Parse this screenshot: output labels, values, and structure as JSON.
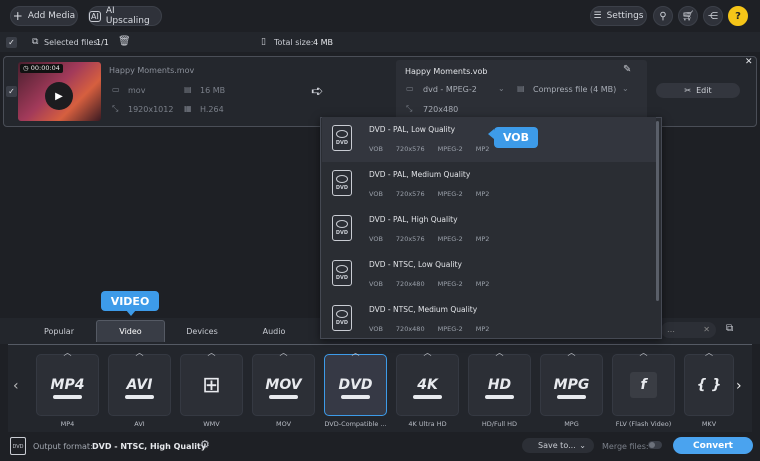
{
  "toolbar": {
    "add_media": "Add Media",
    "ai_upscaling": "AI Upscaling",
    "settings": "Settings"
  },
  "status": {
    "selected_label": "Selected files:",
    "selected_value": "1/1",
    "total_label": "Total size:",
    "total_value": "4 MB"
  },
  "file": {
    "duration": "00:00:04",
    "name": "Happy Moments.mov",
    "container": "mov",
    "size": "16 MB",
    "resolution": "1920x1012",
    "codec": "H.264"
  },
  "output": {
    "name": "Happy Moments.vob",
    "format": "dvd - MPEG-2",
    "compress": "Compress file (4 MB)",
    "resolution": "720x480",
    "edit": "Edit"
  },
  "dropdown": [
    {
      "name": "DVD - PAL, Low Quality",
      "specs": [
        "VOB",
        "720x576",
        "MPEG-2",
        "MP2"
      ]
    },
    {
      "name": "DVD - PAL, Medium Quality",
      "specs": [
        "VOB",
        "720x576",
        "MPEG-2",
        "MP2"
      ]
    },
    {
      "name": "DVD - PAL, High Quality",
      "specs": [
        "VOB",
        "720x576",
        "MPEG-2",
        "MP2"
      ]
    },
    {
      "name": "DVD - NTSC, Low Quality",
      "specs": [
        "VOB",
        "720x480",
        "MPEG-2",
        "MP2"
      ]
    },
    {
      "name": "DVD - NTSC, Medium Quality",
      "specs": [
        "VOB",
        "720x480",
        "MPEG-2",
        "MP2"
      ]
    }
  ],
  "callouts": {
    "vob": "VOB",
    "video": "VIDEO"
  },
  "tabs": [
    "Popular",
    "Video",
    "Devices",
    "Audio"
  ],
  "formats": [
    {
      "logo": "MP4",
      "label": "MP4"
    },
    {
      "logo": "AVI",
      "label": "AVI"
    },
    {
      "logo": "",
      "label": "WMV"
    },
    {
      "logo": "MOV",
      "label": "MOV"
    },
    {
      "logo": "DVD",
      "label": "DVD-Compatible ..."
    },
    {
      "logo": "4K",
      "label": "4K Ultra HD"
    },
    {
      "logo": "HD",
      "label": "HD/Full HD"
    },
    {
      "logo": "MPG",
      "label": "MPG"
    },
    {
      "logo": "f",
      "label": "FLV (Flash Video)"
    },
    {
      "logo": "{ }",
      "label": "MKV"
    }
  ],
  "bottom": {
    "output_label": "Output format:",
    "output_value": "DVD - NTSC, High Quality",
    "save_to": "Save to...",
    "merge": "Merge files:",
    "convert": "Convert"
  },
  "colors": {
    "accent": "#3d9be9",
    "convert": "#4aa3ef"
  }
}
